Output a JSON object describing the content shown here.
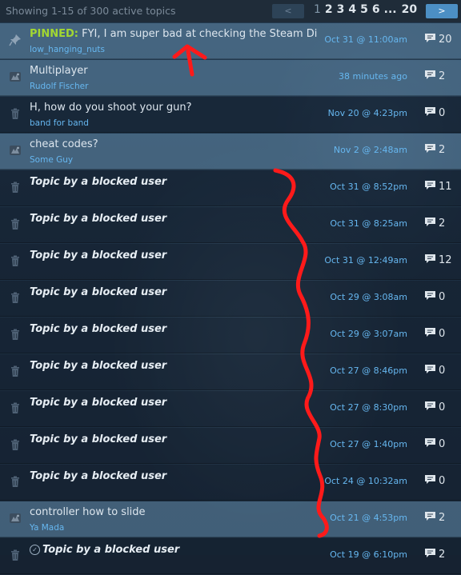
{
  "header": {
    "summary": "Showing 1-15 of 300 active topics",
    "prev_label": "<",
    "next_label": ">",
    "pages": [
      "1",
      "2",
      "3",
      "4",
      "5",
      "6",
      "...",
      "20"
    ],
    "current_page": "1"
  },
  "topics": [
    {
      "pinned_label": "PINNED:",
      "title": "FYI, I am super bad at checking the Steam Discuss...",
      "author": "low_hanging_nuts",
      "time": "Oct 31 @ 11:00am",
      "replies": "20",
      "icon": "pin-icon",
      "highlight": true
    },
    {
      "title": "Multiplayer",
      "author": "Rudolf Fischer",
      "time": "38 minutes ago",
      "replies": "2",
      "icon": "game-avatar-icon",
      "highlight": true
    },
    {
      "title": "H, how do you shoot your gun?",
      "author": "band for band",
      "time": "Nov 20 @ 4:23pm",
      "replies": "0",
      "icon": "trash-icon",
      "highlight": false
    },
    {
      "title": "cheat codes?",
      "author": "Some Guy",
      "time": "Nov 2 @ 2:48am",
      "replies": "2",
      "icon": "game-avatar-icon",
      "highlight": true
    },
    {
      "title": "Topic by a blocked user",
      "blocked": true,
      "time": "Oct 31 @ 8:52pm",
      "replies": "11",
      "icon": "trash-icon"
    },
    {
      "title": "Topic by a blocked user",
      "blocked": true,
      "time": "Oct 31 @ 8:25am",
      "replies": "2",
      "icon": "trash-icon"
    },
    {
      "title": "Topic by a blocked user",
      "blocked": true,
      "time": "Oct 31 @ 12:49am",
      "replies": "12",
      "icon": "trash-icon"
    },
    {
      "title": "Topic by a blocked user",
      "blocked": true,
      "time": "Oct 29 @ 3:08am",
      "replies": "0",
      "icon": "trash-icon"
    },
    {
      "title": "Topic by a blocked user",
      "blocked": true,
      "time": "Oct 29 @ 3:07am",
      "replies": "0",
      "icon": "trash-icon"
    },
    {
      "title": "Topic by a blocked user",
      "blocked": true,
      "time": "Oct 27 @ 8:46pm",
      "replies": "0",
      "icon": "trash-icon"
    },
    {
      "title": "Topic by a blocked user",
      "blocked": true,
      "time": "Oct 27 @ 8:30pm",
      "replies": "0",
      "icon": "trash-icon"
    },
    {
      "title": "Topic by a blocked user",
      "blocked": true,
      "time": "Oct 27 @ 1:40pm",
      "replies": "0",
      "icon": "trash-icon"
    },
    {
      "title": "Topic by a blocked user",
      "blocked": true,
      "time": "Oct 24 @ 10:32am",
      "replies": "0",
      "icon": "trash-icon"
    },
    {
      "title": "controller how to slide",
      "author": "Ya Mada",
      "time": "Oct 21 @ 4:53pm",
      "replies": "2",
      "icon": "game-avatar-icon",
      "highlight": true
    },
    {
      "title": "Topic by a blocked user",
      "blocked": true,
      "answered": true,
      "time": "Oct 19 @ 6:10pm",
      "replies": "2",
      "icon": "trash-icon"
    }
  ],
  "colors": {
    "link": "#66b7f0",
    "pinned": "#a2d732",
    "annotation": "#ff1a1a",
    "highlight_row": "#5f87a8"
  }
}
